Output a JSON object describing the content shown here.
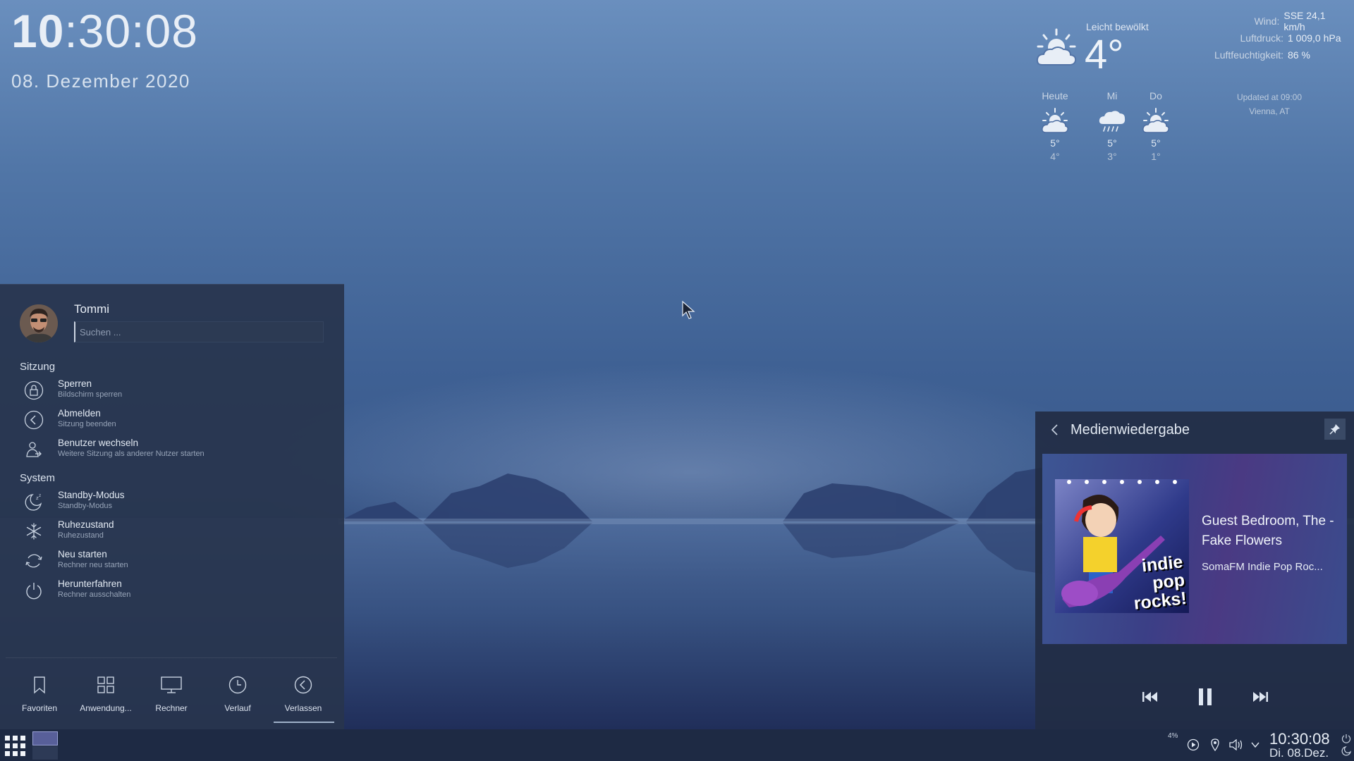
{
  "desktop": {
    "clock": {
      "hours": "10",
      "rest": ":30:08",
      "date": "08. Dezember 2020"
    }
  },
  "weather": {
    "condition": "Leicht bewölkt",
    "temperature": "4°",
    "details": [
      {
        "label": "Wind:",
        "value": "SSE 24,1 km/h"
      },
      {
        "label": "Luftdruck:",
        "value": "1 009,0 hPa"
      },
      {
        "label": "Luftfeuchtigkeit:",
        "value": "86 %"
      }
    ],
    "updated": "Updated at 09:00",
    "location": "Vienna, AT",
    "forecast": [
      {
        "day": "Heute",
        "icon": "partly-cloudy-day-icon",
        "high": "5°",
        "low": "4°"
      },
      {
        "day": "Mi",
        "icon": "rain-icon",
        "high": "5°",
        "low": "3°"
      },
      {
        "day": "Do",
        "icon": "partly-cloudy-day-icon",
        "high": "5°",
        "low": "1°"
      }
    ]
  },
  "menu": {
    "user": "Tommi",
    "search_placeholder": "Suchen ...",
    "section_session": "Sitzung",
    "section_system": "System",
    "session_items": [
      {
        "title": "Sperren",
        "subtitle": "Bildschirm sperren",
        "icon": "lock-icon"
      },
      {
        "title": "Abmelden",
        "subtitle": "Sitzung beenden",
        "icon": "logout-icon"
      },
      {
        "title": "Benutzer wechseln",
        "subtitle": "Weitere Sitzung als anderer Nutzer starten",
        "icon": "switch-user-icon"
      }
    ],
    "system_items": [
      {
        "title": "Standby-Modus",
        "subtitle": "Standby-Modus",
        "icon": "standby-icon"
      },
      {
        "title": "Ruhezustand",
        "subtitle": "Ruhezustand",
        "icon": "hibernate-icon"
      },
      {
        "title": "Neu starten",
        "subtitle": "Rechner neu starten",
        "icon": "restart-icon"
      },
      {
        "title": "Herunterfahren",
        "subtitle": "Rechner ausschalten",
        "icon": "power-icon"
      }
    ],
    "tabs": [
      {
        "label": "Favoriten",
        "icon": "bookmark-icon"
      },
      {
        "label": "Anwendung...",
        "icon": "grid-icon"
      },
      {
        "label": "Rechner",
        "icon": "computer-icon"
      },
      {
        "label": "Verlauf",
        "icon": "clock-icon"
      },
      {
        "label": "Verlassen",
        "icon": "leave-icon"
      }
    ],
    "active_tab": "Verlassen"
  },
  "media": {
    "title": "Medienwiedergabe",
    "track": "Guest Bedroom, The - Fake Flowers",
    "station": "SomaFM Indie Pop Roc...",
    "album_art_text": [
      "indie",
      "pop",
      "rocks!"
    ],
    "state": "playing"
  },
  "taskbar": {
    "tray_percent": "4%",
    "time": "10:30:08",
    "date": "Di. 08.Dez."
  }
}
